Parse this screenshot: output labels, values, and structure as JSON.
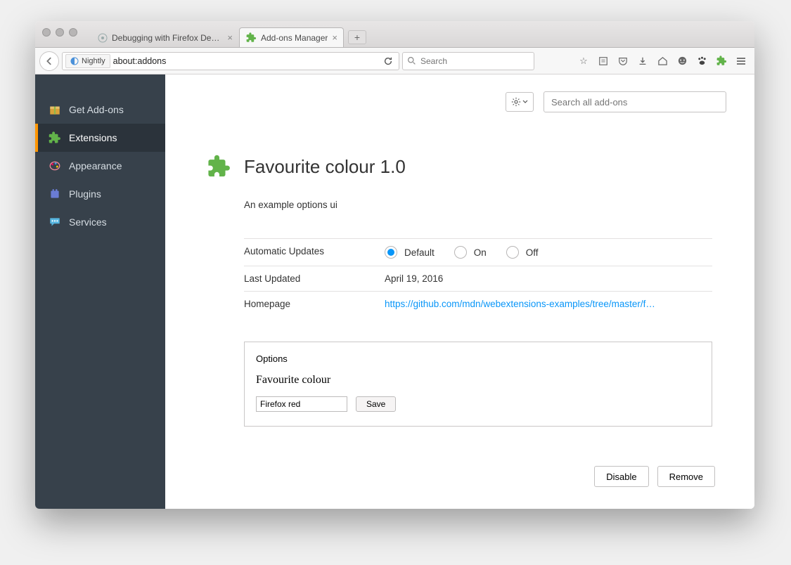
{
  "tabs": [
    {
      "label": "Debugging with Firefox Develop…",
      "active": false
    },
    {
      "label": "Add-ons Manager",
      "active": true
    }
  ],
  "urlbar": {
    "identity": "Nightly",
    "url": "about:addons",
    "search_placeholder": "Search"
  },
  "sidebar": {
    "items": [
      {
        "label": "Get Add-ons"
      },
      {
        "label": "Extensions"
      },
      {
        "label": "Appearance"
      },
      {
        "label": "Plugins"
      },
      {
        "label": "Services"
      }
    ],
    "active_index": 1
  },
  "header": {
    "addon_search_placeholder": "Search all add-ons"
  },
  "addon": {
    "title": "Favourite colour 1.0",
    "description": "An example options ui",
    "rows": {
      "updates_label": "Automatic Updates",
      "updates_options": [
        "Default",
        "On",
        "Off"
      ],
      "updates_selected": "Default",
      "last_updated_label": "Last Updated",
      "last_updated_value": "April 19, 2016",
      "homepage_label": "Homepage",
      "homepage_value": "https://github.com/mdn/webextensions-examples/tree/master/f…"
    },
    "options": {
      "legend": "Options",
      "field_label": "Favourite colour",
      "input_value": "Firefox red",
      "save_label": "Save"
    },
    "actions": {
      "disable": "Disable",
      "remove": "Remove"
    }
  }
}
